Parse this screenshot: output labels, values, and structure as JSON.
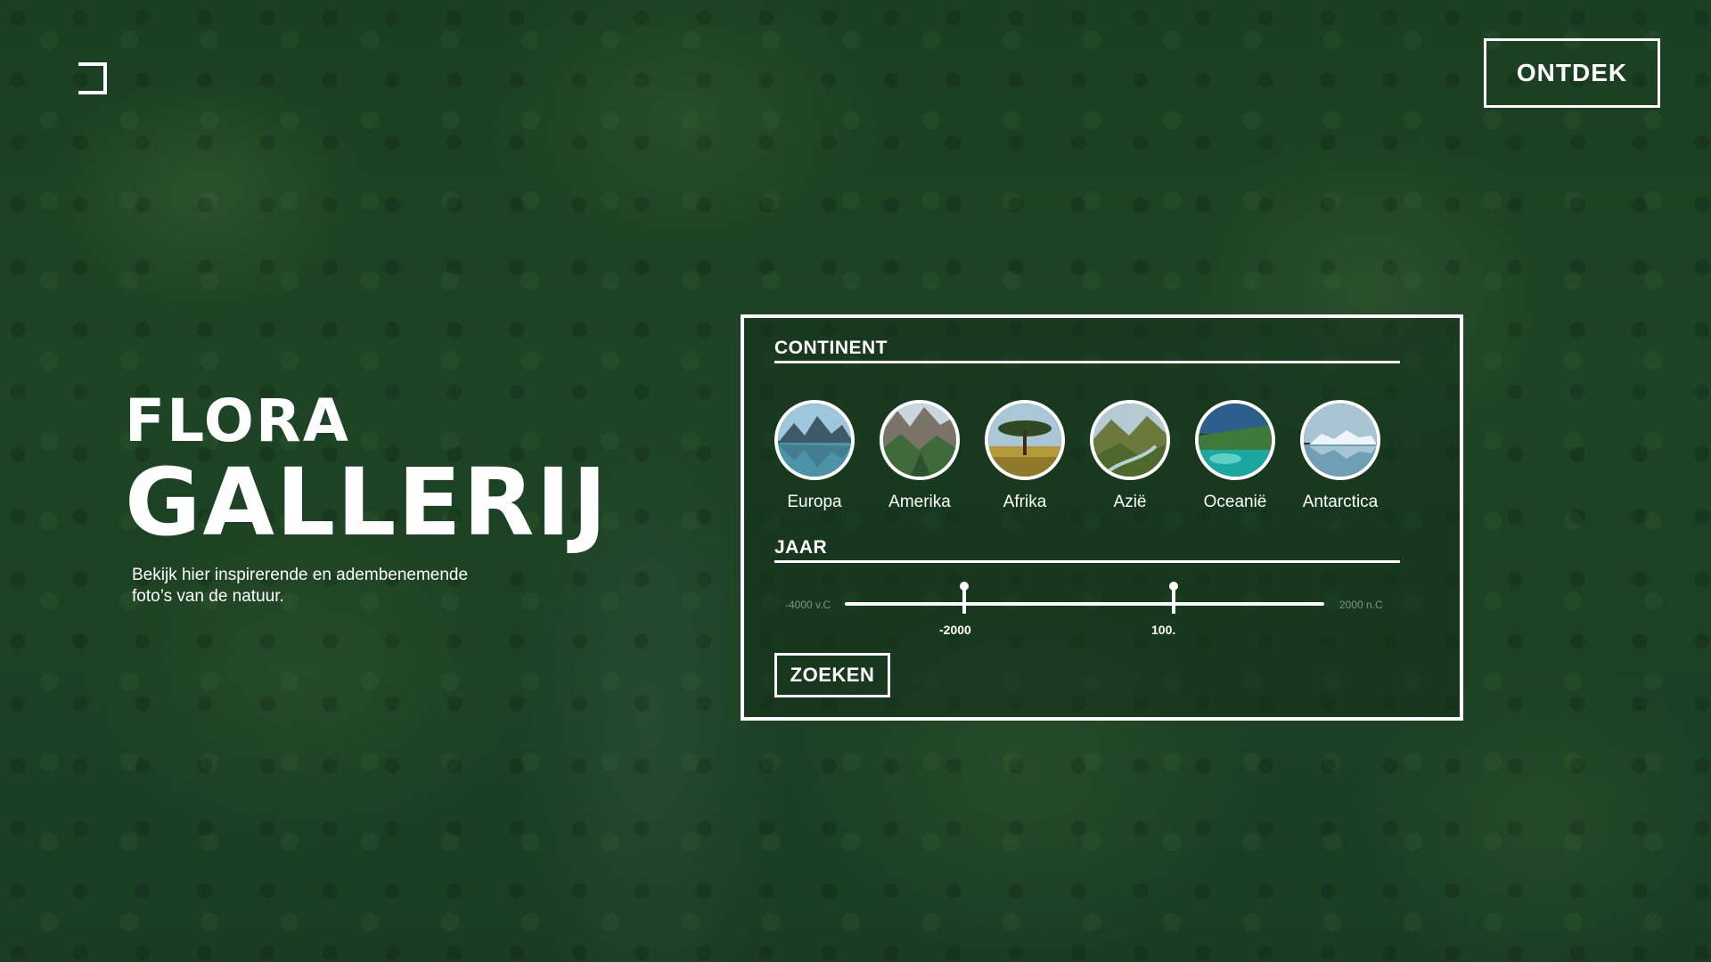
{
  "header": {
    "logo_icon": "bracket-logo-icon",
    "discover_label": "ONTDEK"
  },
  "hero": {
    "title_top": "FLORA",
    "title_main": "GALLERIJ",
    "subtitle": "Bekijk hier inspirerende en adembenemende foto’s van de natuur."
  },
  "filter": {
    "continent_label": "CONTINENT",
    "continents": [
      {
        "name": "Europa",
        "icon": "mountain-lake-thumbnail"
      },
      {
        "name": "Amerika",
        "icon": "canyon-mountain-thumbnail"
      },
      {
        "name": "Afrika",
        "icon": "savanna-tree-thumbnail"
      },
      {
        "name": "Azië",
        "icon": "river-valley-thumbnail"
      },
      {
        "name": "Oceanië",
        "icon": "tropical-lagoon-thumbnail"
      },
      {
        "name": "Antarctica",
        "icon": "iceberg-thumbnail"
      }
    ],
    "year_label": "JAAR",
    "range_min_label": "-4000 v.C",
    "range_max_label": "2000 n.C",
    "handle_start_value": "-2000",
    "handle_end_value": "100.",
    "search_label": "ZOEKEN"
  },
  "colors": {
    "background": "#1b3f21",
    "foreground": "#ffffff"
  }
}
